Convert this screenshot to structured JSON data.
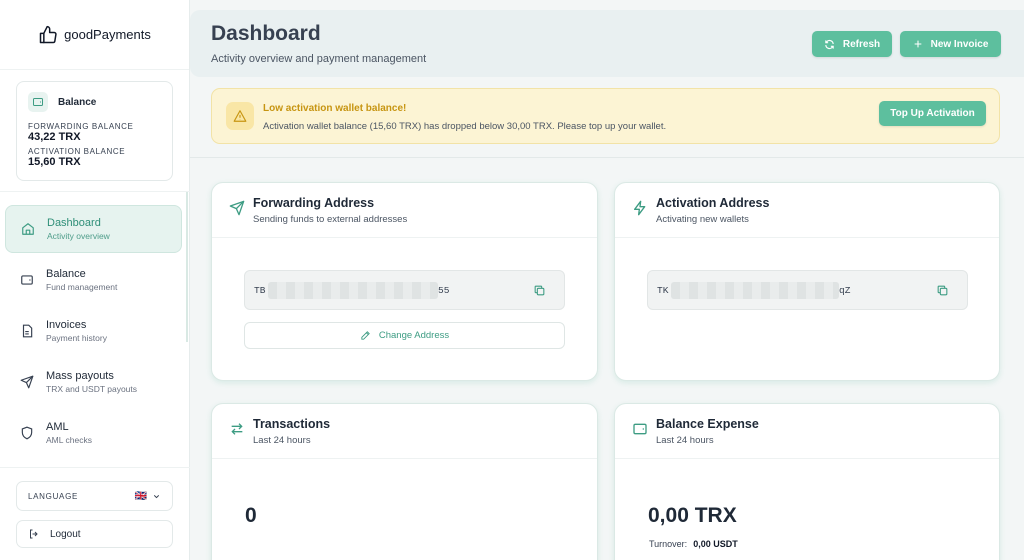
{
  "brand": {
    "name": "goodPayments"
  },
  "balance_card": {
    "title": "Balance",
    "forwarding_label": "FORWARDING BALANCE",
    "forwarding_value": "43,22 TRX",
    "activation_label": "ACTIVATION BALANCE",
    "activation_value": "15,60 TRX"
  },
  "nav": [
    {
      "label": "Dashboard",
      "sub": "Activity overview",
      "icon": "home-icon",
      "active": true
    },
    {
      "label": "Balance",
      "sub": "Fund management",
      "icon": "wallet-icon"
    },
    {
      "label": "Invoices",
      "sub": "Payment history",
      "icon": "document-icon"
    },
    {
      "label": "Mass payouts",
      "sub": "TRX and USDT payouts",
      "icon": "send-icon"
    },
    {
      "label": "AML",
      "sub": "AML checks",
      "icon": "shield-icon"
    }
  ],
  "language": {
    "label": "LANGUAGE",
    "flag": "🇬🇧"
  },
  "logout": {
    "label": "Logout"
  },
  "header": {
    "title": "Dashboard",
    "subtitle": "Activity overview and payment management",
    "refresh_label": "Refresh",
    "new_invoice_label": "New Invoice"
  },
  "alert": {
    "title": "Low activation wallet balance!",
    "text": "Activation wallet balance (15,60 TRX) has dropped below 30,00 TRX. Please top up your wallet.",
    "button": "Top Up Activation"
  },
  "cards": {
    "forwarding": {
      "title": "Forwarding Address",
      "subtitle": "Sending funds to external addresses",
      "address_prefix": "TB",
      "address_suffix": "55",
      "change_label": "Change Address"
    },
    "activation": {
      "title": "Activation Address",
      "subtitle": "Activating new wallets",
      "address_prefix": "TK",
      "address_suffix": "qZ"
    },
    "transactions": {
      "title": "Transactions",
      "subtitle": "Last 24 hours",
      "value": "0"
    },
    "expense": {
      "title": "Balance Expense",
      "subtitle": "Last 24 hours",
      "value": "0,00 TRX",
      "turnover_label": "Turnover:",
      "turnover_value": "0,00 USDT"
    }
  },
  "colors": {
    "accent": "#5dbf9e",
    "warning": "#c79512",
    "alert_bg": "#fcf4d4"
  }
}
